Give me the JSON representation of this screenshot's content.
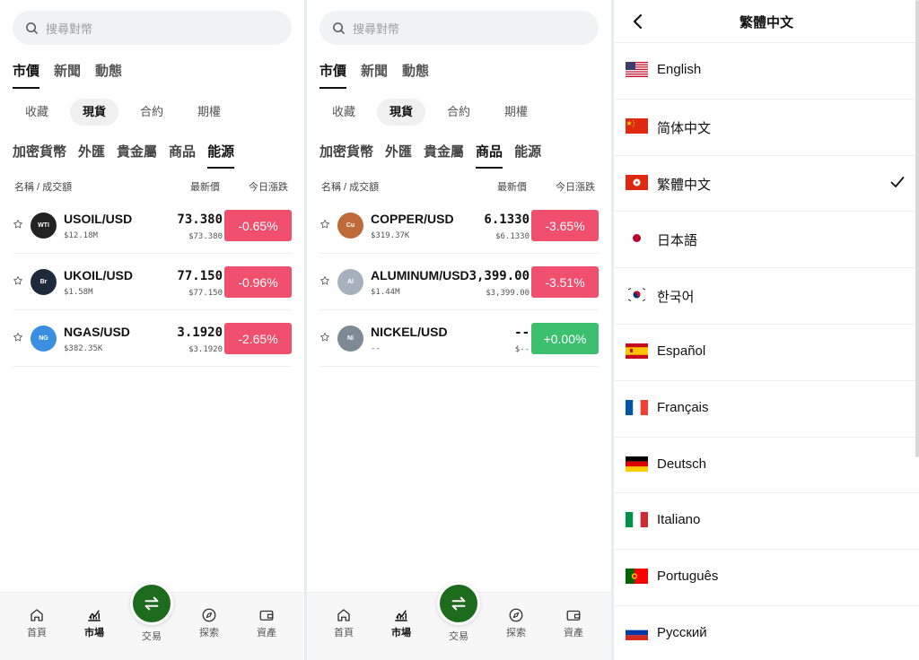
{
  "markets": {
    "search_placeholder": "搜尋對幣",
    "top_tabs": [
      "市價",
      "新聞",
      "動態"
    ],
    "sub_tabs": [
      "收藏",
      "現貨",
      "合約",
      "期權"
    ],
    "categories": [
      "加密貨幣",
      "外匯",
      "貴金屬",
      "商品",
      "能源"
    ],
    "col_name": "名稱 / 成交額",
    "col_price": "最新價",
    "col_change": "今日漲跌"
  },
  "panel1": {
    "active_category": "能源",
    "rows": [
      {
        "coin": "WTI",
        "symbol": "USOIL/USD",
        "volume": "$12.18M",
        "price": "73.380",
        "sub": "$73.380",
        "change": "-0.65%",
        "dir": "down"
      },
      {
        "coin": "Br",
        "symbol": "UKOIL/USD",
        "volume": "$1.58M",
        "price": "77.150",
        "sub": "$77.150",
        "change": "-0.96%",
        "dir": "down"
      },
      {
        "coin": "NG",
        "symbol": "NGAS/USD",
        "volume": "$382.35K",
        "price": "3.1920",
        "sub": "$3.1920",
        "change": "-2.65%",
        "dir": "down"
      }
    ]
  },
  "panel2": {
    "active_category": "商品",
    "rows": [
      {
        "coin": "Cu",
        "symbol": "COPPER/USD",
        "volume": "$319.37K",
        "price": "6.1330",
        "sub": "$6.1330",
        "change": "-3.65%",
        "dir": "down"
      },
      {
        "coin": "Al",
        "symbol": "ALUMINUM/USD",
        "volume": "$1.44M",
        "price": "3,399.00",
        "sub": "$3,399.00",
        "change": "-3.51%",
        "dir": "down"
      },
      {
        "coin": "Ni",
        "symbol": "NICKEL/USD",
        "volume": "--",
        "price": "--",
        "sub": "$--",
        "change": "+0.00%",
        "dir": "up"
      }
    ]
  },
  "nav": {
    "home": "首頁",
    "market": "市場",
    "trade": "交易",
    "explore": "探索",
    "assets": "資產"
  },
  "language": {
    "title": "繁體中文",
    "selected": "繁體中文",
    "items": [
      "English",
      "简体中文",
      "繁體中文",
      "日本語",
      "한국어",
      "Español",
      "Français",
      "Deutsch",
      "Italiano",
      "Português",
      "Русский"
    ]
  },
  "colors": {
    "down": "#f0506e",
    "up": "#3cbf6e",
    "trade_button": "#1d6b1d",
    "coin_WTI": "#222222",
    "coin_Br": "#1e2a3b",
    "coin_NG": "#3a8fe0",
    "coin_Cu": "#c06a3c",
    "coin_Al": "#a7b1bd",
    "coin_Ni": "#7d8a95"
  }
}
